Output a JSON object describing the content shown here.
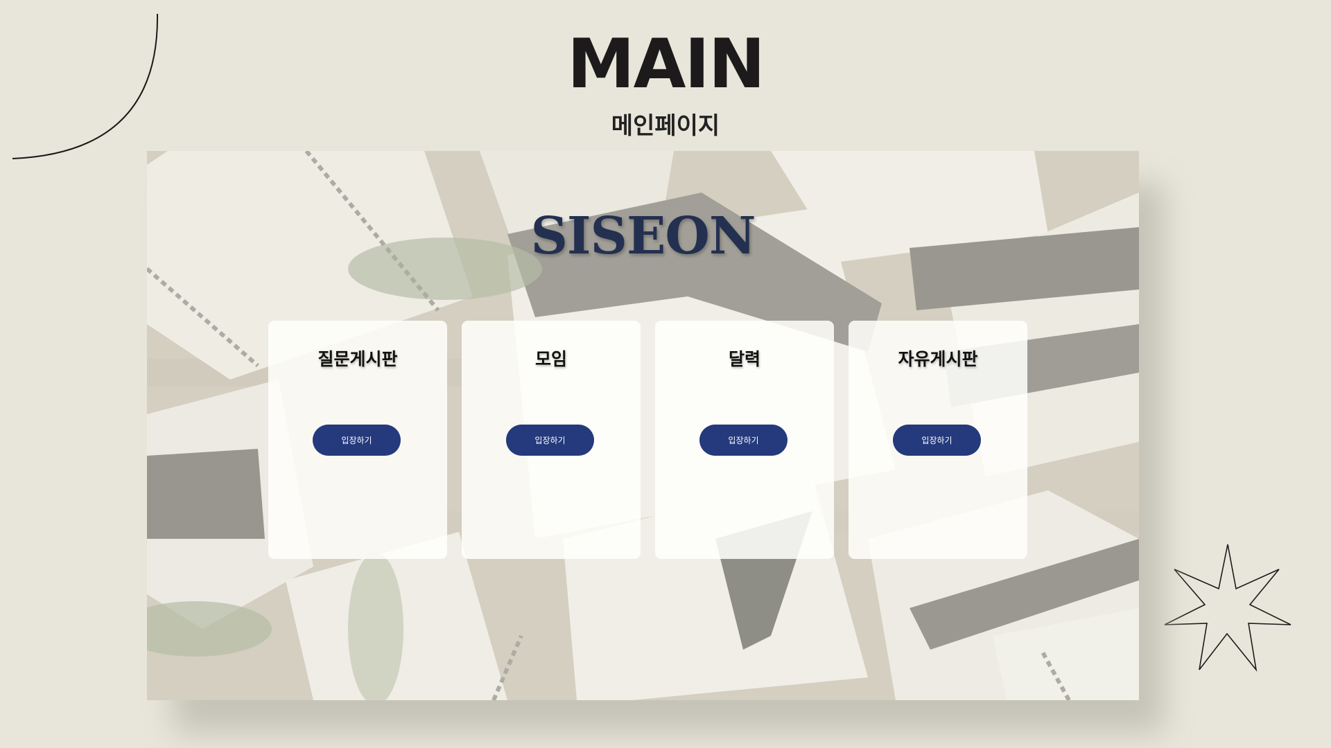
{
  "header": {
    "title": "MAIN",
    "subtitle": "메인페이지"
  },
  "panel": {
    "brand": "SISEON",
    "background": "wrapped-gift-boxes-photo"
  },
  "cards": [
    {
      "title": "질문게시판",
      "button_label": "입장하기"
    },
    {
      "title": "모임",
      "button_label": "입장하기"
    },
    {
      "title": "달력",
      "button_label": "입장하기"
    },
    {
      "title": "자유게시판",
      "button_label": "입장하기"
    }
  ],
  "colors": {
    "page_bg": "#e8e6da",
    "brand": "#243050",
    "button": "#253a7c",
    "title": "#1c1a1a"
  },
  "icons": [
    "decorative-arc-icon",
    "decorative-star-icon"
  ]
}
